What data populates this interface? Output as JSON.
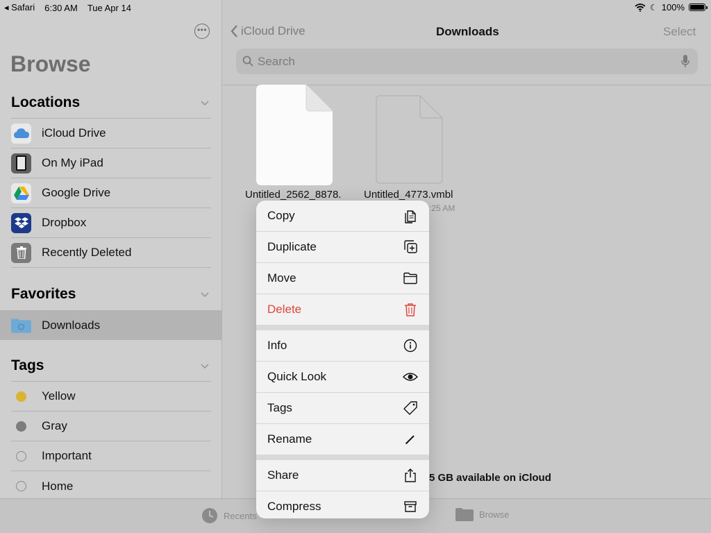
{
  "status_bar": {
    "app": "Safari",
    "time": "6:30 AM",
    "date": "Tue Apr 14",
    "battery": "100%"
  },
  "sidebar": {
    "title": "Browse",
    "locations": {
      "header": "Locations",
      "items": [
        {
          "label": "iCloud Drive",
          "icon": "icloud-icon"
        },
        {
          "label": "On My iPad",
          "icon": "ipad-icon"
        },
        {
          "label": "Google Drive",
          "icon": "google-drive-icon"
        },
        {
          "label": "Dropbox",
          "icon": "dropbox-icon"
        },
        {
          "label": "Recently Deleted",
          "icon": "trash-icon"
        }
      ]
    },
    "favorites": {
      "header": "Favorites",
      "items": [
        {
          "label": "Downloads",
          "icon": "folder-icon"
        }
      ]
    },
    "tags": {
      "header": "Tags",
      "items": [
        {
          "label": "Yellow",
          "color": "#d9b433"
        },
        {
          "label": "Gray",
          "color": "#7d7d80"
        },
        {
          "label": "Important",
          "color": ""
        },
        {
          "label": "Home",
          "color": ""
        }
      ]
    }
  },
  "nav": {
    "back": "iCloud Drive",
    "title": "Downloads",
    "select": "Select"
  },
  "search": {
    "placeholder": "Search"
  },
  "files": [
    {
      "name": "Untitled_2562_8878.",
      "sub": ""
    },
    {
      "name": "Untitled_4773.vmbl",
      "sub": ":25 AM"
    }
  ],
  "storage": "5 GB available on iCloud",
  "tabbar": {
    "recents": "Recents",
    "browse": "Browse"
  },
  "context_menu": {
    "groups": [
      [
        {
          "label": "Copy",
          "icon": "copy-icon"
        },
        {
          "label": "Duplicate",
          "icon": "duplicate-icon"
        },
        {
          "label": "Move",
          "icon": "folder-icon"
        },
        {
          "label": "Delete",
          "icon": "trash-icon",
          "destructive": true
        }
      ],
      [
        {
          "label": "Info",
          "icon": "info-icon"
        },
        {
          "label": "Quick Look",
          "icon": "eye-icon"
        },
        {
          "label": "Tags",
          "icon": "tag-icon"
        },
        {
          "label": "Rename",
          "icon": "pencil-icon"
        }
      ],
      [
        {
          "label": "Share",
          "icon": "share-icon"
        },
        {
          "label": "Compress",
          "icon": "archive-icon"
        }
      ]
    ]
  },
  "colors": {
    "destructive": "#e0453a",
    "selected_row": "#b4b4b4"
  }
}
